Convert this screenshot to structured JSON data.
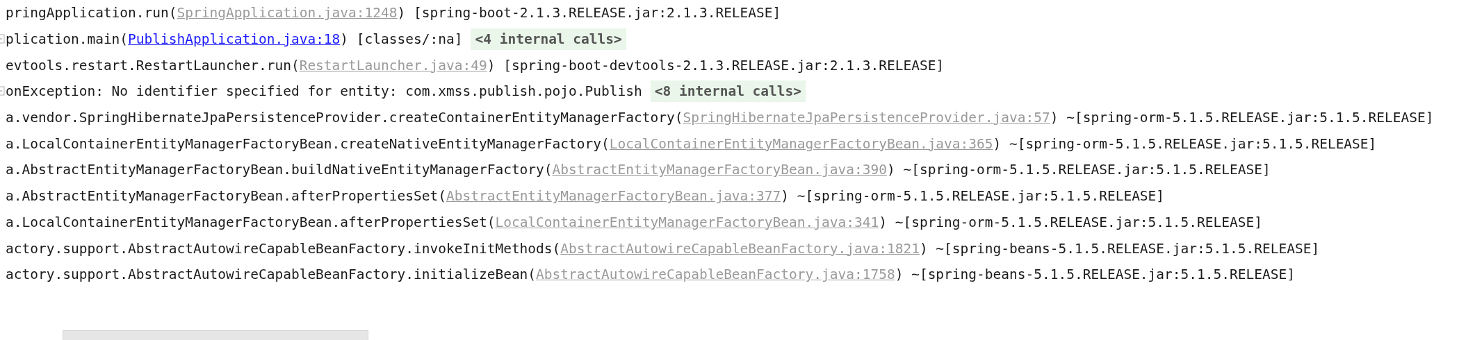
{
  "lines": [
    {
      "fold": false,
      "segments": [
        {
          "kind": "text",
          "text": "pringApplication.run("
        },
        {
          "kind": "library_link",
          "text": "SpringApplication.java:1248"
        },
        {
          "kind": "text",
          "text": ") [spring-boot-2.1.3.RELEASE.jar:2.1.3.RELEASE]"
        }
      ]
    },
    {
      "fold": true,
      "segments": [
        {
          "kind": "text",
          "text": "plication.main("
        },
        {
          "kind": "link",
          "text": "PublishApplication.java:18"
        },
        {
          "kind": "text",
          "text": ") [classes/:na]"
        },
        {
          "kind": "collapsed",
          "text": "<4 internal calls>"
        }
      ]
    },
    {
      "fold": false,
      "segments": [
        {
          "kind": "text",
          "text": "evtools.restart.RestartLauncher.run("
        },
        {
          "kind": "library_link",
          "text": "RestartLauncher.java:49"
        },
        {
          "kind": "text",
          "text": ") [spring-boot-devtools-2.1.3.RELEASE.jar:2.1.3.RELEASE]"
        }
      ]
    },
    {
      "fold": true,
      "segments": [
        {
          "kind": "text",
          "text": "onException: No identifier specified for entity: com.xmss.publish.pojo.Publish"
        },
        {
          "kind": "collapsed",
          "text": "<8 internal calls>"
        }
      ]
    },
    {
      "fold": false,
      "segments": [
        {
          "kind": "text",
          "text": "a.vendor.SpringHibernateJpaPersistenceProvider.createContainerEntityManagerFactory("
        },
        {
          "kind": "library_link",
          "text": "SpringHibernateJpaPersistenceProvider.java:57"
        },
        {
          "kind": "text",
          "text": ") ~[spring-orm-5.1.5.RELEASE.jar:5.1.5.RELEASE]"
        }
      ]
    },
    {
      "fold": false,
      "segments": [
        {
          "kind": "text",
          "text": "a.LocalContainerEntityManagerFactoryBean.createNativeEntityManagerFactory("
        },
        {
          "kind": "library_link",
          "text": "LocalContainerEntityManagerFactoryBean.java:365"
        },
        {
          "kind": "text",
          "text": ") ~[spring-orm-5.1.5.RELEASE.jar:5.1.5.RELEASE]"
        }
      ]
    },
    {
      "fold": false,
      "segments": [
        {
          "kind": "text",
          "text": "a.AbstractEntityManagerFactoryBean.buildNativeEntityManagerFactory("
        },
        {
          "kind": "library_link",
          "text": "AbstractEntityManagerFactoryBean.java:390"
        },
        {
          "kind": "text",
          "text": ") ~[spring-orm-5.1.5.RELEASE.jar:5.1.5.RELEASE]"
        }
      ]
    },
    {
      "fold": false,
      "segments": [
        {
          "kind": "text",
          "text": "a.AbstractEntityManagerFactoryBean.afterPropertiesSet("
        },
        {
          "kind": "library_link",
          "text": "AbstractEntityManagerFactoryBean.java:377"
        },
        {
          "kind": "text",
          "text": ") ~[spring-orm-5.1.5.RELEASE.jar:5.1.5.RELEASE]"
        }
      ]
    },
    {
      "fold": false,
      "segments": [
        {
          "kind": "text",
          "text": "a.LocalContainerEntityManagerFactoryBean.afterPropertiesSet("
        },
        {
          "kind": "library_link",
          "text": "LocalContainerEntityManagerFactoryBean.java:341"
        },
        {
          "kind": "text",
          "text": ") ~[spring-orm-5.1.5.RELEASE.jar:5.1.5.RELEASE]"
        }
      ]
    },
    {
      "fold": false,
      "segments": [
        {
          "kind": "text",
          "text": "actory.support.AbstractAutowireCapableBeanFactory.invokeInitMethods("
        },
        {
          "kind": "library_link",
          "text": "AbstractAutowireCapableBeanFactory.java:1821"
        },
        {
          "kind": "text",
          "text": ") ~[spring-beans-5.1.5.RELEASE.jar:5.1.5.RELEASE]"
        }
      ]
    },
    {
      "fold": false,
      "segments": [
        {
          "kind": "text",
          "text": "actory.support.AbstractAutowireCapableBeanFactory.initializeBean("
        },
        {
          "kind": "library_link",
          "text": "AbstractAutowireCapableBeanFactory.java:1758"
        },
        {
          "kind": "text",
          "text": ") ~[spring-beans-5.1.5.RELEASE.jar:5.1.5.RELEASE]"
        }
      ]
    }
  ]
}
